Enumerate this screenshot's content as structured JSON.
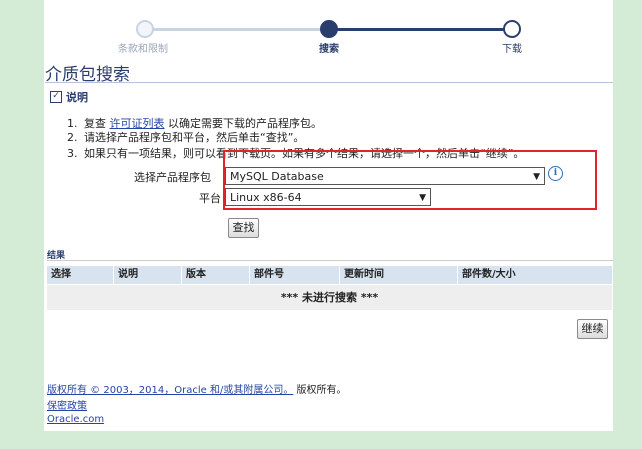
{
  "train": {
    "steps": [
      {
        "label": "条款和限制",
        "state": "visited"
      },
      {
        "label": "搜索",
        "state": "current"
      },
      {
        "label": "下载",
        "state": "next"
      }
    ]
  },
  "page": {
    "title": "介质包搜索"
  },
  "instructions": {
    "header": "说明",
    "item1_num": "1.",
    "item1_pre": "复查",
    "item1_link": "许可证列表",
    "item1_post": "以确定需要下载的产品程序包。",
    "item2_num": "2.",
    "item2": "请选择产品程序包和平台，然后单击“查找”。",
    "item3_num": "3.",
    "item3": "如果只有一项结果，则可以看到下载页。如果有多个结果，请选择一个，然后单击“继续”。"
  },
  "form": {
    "product_label": "选择产品程序包",
    "product_value": "MySQL Database",
    "platform_label": "平台",
    "platform_value": "Linux x86-64",
    "search_button": "查找"
  },
  "results": {
    "title": "结果",
    "columns": [
      "选择",
      "说明",
      "版本",
      "部件号",
      "更新时间",
      "部件数/大小"
    ],
    "empty_message": "*** 未进行搜索 ***",
    "continue_button": "继续"
  },
  "footer": {
    "copyright_link": "版权所有 © 2003，2014，Oracle 和/或其附属公司。",
    "copyright_suffix": "版权所有。",
    "privacy_link": "保密政策",
    "oracle_link": "Oracle.com"
  },
  "colors": {
    "accent": "#2a3e6e",
    "highlight_box": "#e0242a",
    "background": "#d4ecd6"
  }
}
